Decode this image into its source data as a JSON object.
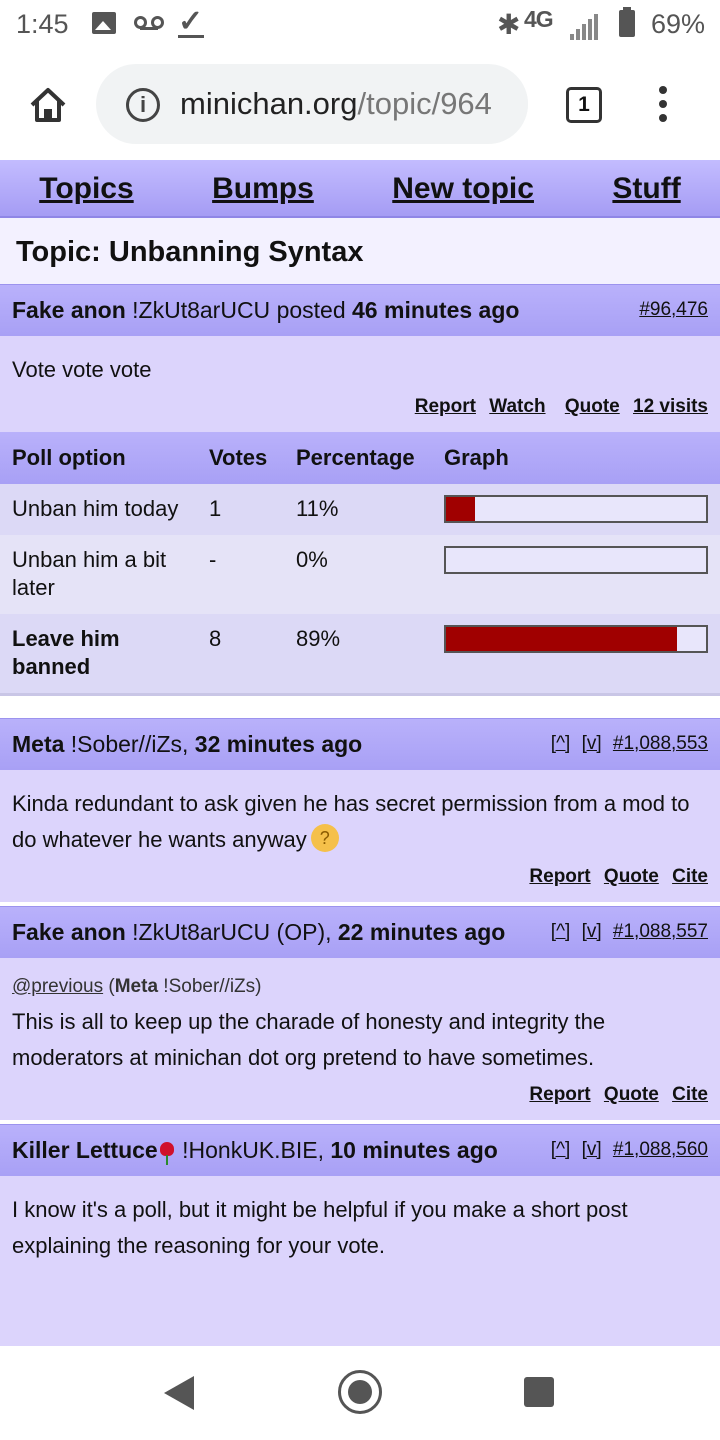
{
  "status_bar": {
    "time": "1:45",
    "network": "4G",
    "battery": "69%"
  },
  "browser": {
    "url_host": "minichan.org",
    "url_path": "/topic/964",
    "tab_count": "1"
  },
  "nav": {
    "items": [
      "Topics",
      "Bumps",
      "New topic",
      "Stuff"
    ]
  },
  "topic": {
    "title": "Topic: Unbanning Syntax"
  },
  "op": {
    "author": "Fake anon",
    "tripcode": "!ZkUt8arUCU",
    "posted_label": "posted",
    "time": "46 minutes ago",
    "id": "#96,476",
    "body": "Vote vote vote",
    "actions": [
      "Report",
      "Watch",
      "Quote",
      "12 visits"
    ]
  },
  "poll": {
    "headers": [
      "Poll option",
      "Votes",
      "Percentage",
      "Graph"
    ],
    "rows": [
      {
        "option": "Unban him today",
        "votes": "1",
        "percentage": "11%",
        "fraction": 0.11
      },
      {
        "option": "Unban him a bit later",
        "votes": "-",
        "percentage": "0%",
        "fraction": 0
      },
      {
        "option": "Leave him banned",
        "votes": "8",
        "percentage": "89%",
        "fraction": 0.89
      }
    ]
  },
  "replies": [
    {
      "author": "Meta",
      "tripcode": "!Sober//iZs,",
      "time": "32 minutes ago",
      "up": "[^]",
      "down": "[v]",
      "id": "#1,088,553",
      "body": "Kinda redundant to ask given he has secret permission from a mod to do whatever he wants anyway",
      "actions": [
        "Report",
        "Quote",
        "Cite"
      ]
    },
    {
      "author": "Fake anon",
      "tripcode": "!ZkUt8arUCU (OP),",
      "time": "22 minutes ago",
      "up": "[^]",
      "down": "[v]",
      "id": "#1,088,557",
      "cite_link": "@previous",
      "cite_author": "Meta",
      "cite_trip": "!Sober//iZs",
      "body": "This is all to keep up the charade of honesty and integrity the moderators at minichan dot org pretend to have sometimes.",
      "actions": [
        "Report",
        "Quote",
        "Cite"
      ]
    },
    {
      "author": "Killer Lettuce",
      "tripcode": "!HonkUK.BIE,",
      "time": "10 minutes ago",
      "up": "[^]",
      "down": "[v]",
      "id": "#1,088,560",
      "body": "I know it's a poll, but it might be helpful if you make a short post explaining the reasoning for your vote."
    }
  ],
  "colors": {
    "header": "#a8a0f5",
    "body": "#dcd4fc",
    "bar_fill": "#a00000"
  }
}
